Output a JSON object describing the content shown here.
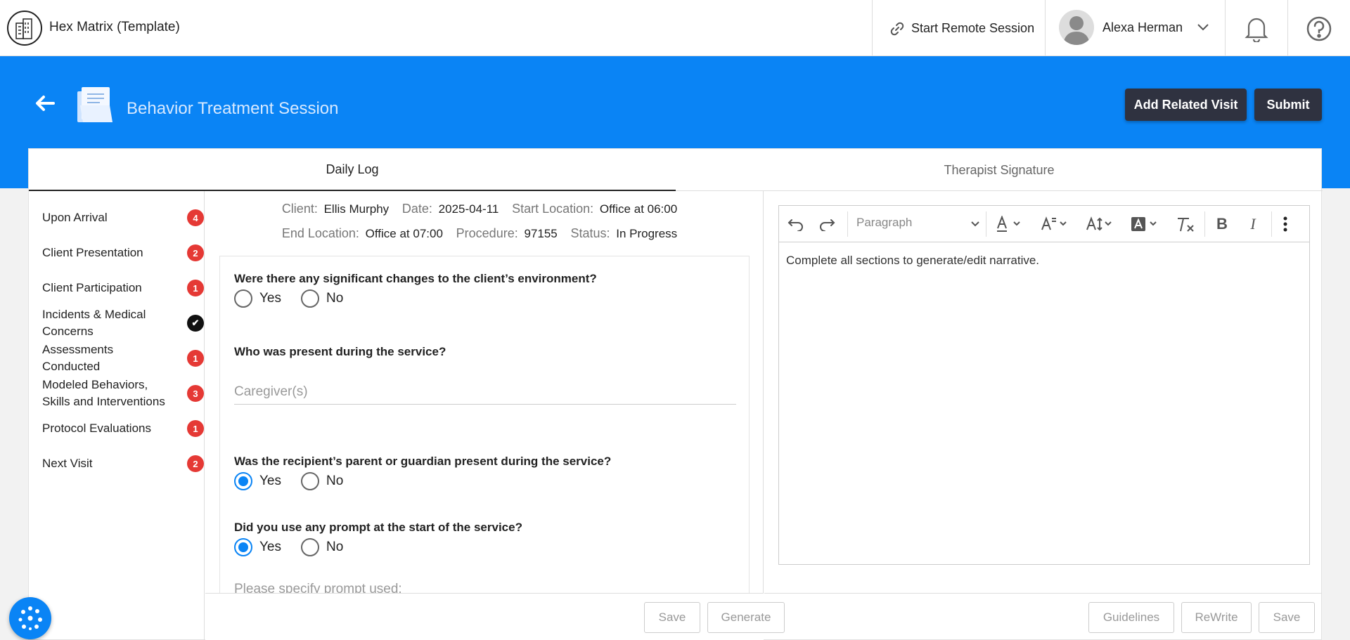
{
  "app": {
    "title": "Hex Matrix (Template)"
  },
  "topbar": {
    "remote_label": "Start Remote Session",
    "user_name": "Alexa Herman"
  },
  "header": {
    "title": "Behavior Treatment Session",
    "add_related_label": "Add Related Visit",
    "submit_label": "Submit"
  },
  "tabs": [
    {
      "label": "Daily Log",
      "active": true
    },
    {
      "label": "Therapist Signature",
      "active": false
    }
  ],
  "sidebar": {
    "items": [
      {
        "label": "Upon Arrival",
        "badge": "4"
      },
      {
        "label": "Client Presentation",
        "badge": "2"
      },
      {
        "label": "Client Participation",
        "badge": "1"
      },
      {
        "label": "Incidents & Medical Concerns",
        "badge": "✔"
      },
      {
        "label": "Assessments Conducted",
        "badge": "1"
      },
      {
        "label": "Modeled Behaviors, Skills and Interventions",
        "badge": "3"
      },
      {
        "label": "Protocol Evaluations",
        "badge": "1"
      },
      {
        "label": "Next Visit",
        "badge": "2"
      }
    ]
  },
  "session": {
    "client_k": "Client:",
    "client_v": "Ellis Murphy",
    "date_k": "Date:",
    "date_v": "2025-04-11",
    "start_k": "Start Location:",
    "start_v": "Office at 06:00",
    "end_k": "End Location:",
    "end_v": "Office at 07:00",
    "proc_k": "Procedure:",
    "proc_v": "97155",
    "status_k": "Status:",
    "status_v": "In Progress"
  },
  "form": {
    "q1": "Were there any significant changes to the client’s environment?",
    "q1_selected": "none",
    "q2": "Who was present during the service?",
    "q2_placeholder": "Caregiver(s)",
    "q3": "Was the recipient’s parent or guardian present during the service?",
    "q3_selected": "Yes",
    "q4": "Did you use any prompt at the start of the service?",
    "q4_selected": "Yes",
    "q5_placeholder": "Please specify prompt used:",
    "yes": "Yes",
    "no": "No",
    "save_label": "Save",
    "generate_label": "Generate"
  },
  "editor": {
    "block_format": "Paragraph",
    "content": "Complete all sections to generate/edit narrative.",
    "guidelines_label": "Guidelines",
    "rewrite_label": "ReWrite",
    "save_label": "Save"
  },
  "colors": {
    "brand_blue": "#0a84f5",
    "badge_red": "#e53935",
    "dark_button": "#2f3240"
  }
}
